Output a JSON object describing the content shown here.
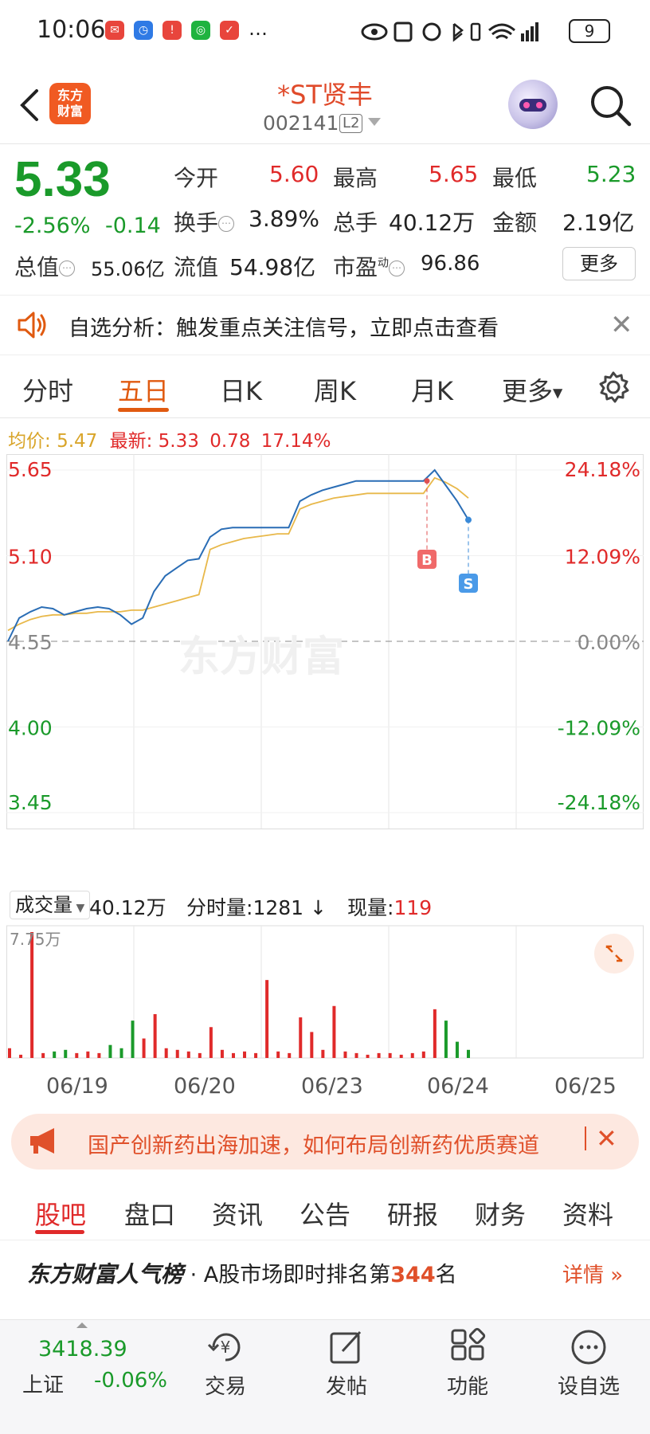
{
  "status_bar": {
    "time": "10:06",
    "battery": "9",
    "more": "…"
  },
  "header": {
    "title": "*ST贤丰",
    "code": "002141",
    "level": "L2",
    "logo_text": "东方财富"
  },
  "quote": {
    "price": "5.33",
    "change_pct": "-2.56%",
    "change_amt": "-0.14",
    "open_label": "今开",
    "open": "5.60",
    "high_label": "最高",
    "high": "5.65",
    "low_label": "最低",
    "low": "5.23",
    "turnover_label": "换手",
    "turnover": "3.89%",
    "volume_label": "总手",
    "volume": "40.12万",
    "amount_label": "金额",
    "amount": "2.19亿",
    "mcap_label": "总值",
    "mcap": "55.06亿",
    "float_label": "流值",
    "float": "54.98亿",
    "pe_label": "市盈",
    "pe_sup": "动",
    "pe": "96.86",
    "more_label": "更多"
  },
  "analysis_banner": {
    "text": "自选分析：触发重点关注信号，立即点击查看"
  },
  "tabs": [
    "分时",
    "五日",
    "日K",
    "周K",
    "月K",
    "更多"
  ],
  "legend": {
    "avg_label": "均价:",
    "avg": "5.47",
    "latest_label": "最新:",
    "latest": "5.33",
    "latest_chg": "0.78",
    "latest_pct": "17.14%"
  },
  "chart_data": {
    "type": "line",
    "y_left_ticks": [
      "5.65",
      "5.10",
      "4.55",
      "4.00",
      "3.45"
    ],
    "y_right_ticks": [
      "24.18%",
      "12.09%",
      "0.00%",
      "-12.09%",
      "-24.18%"
    ],
    "ylim": [
      3.45,
      5.65
    ],
    "prev_close": 4.55,
    "x_labels": [
      "06/19",
      "06/20",
      "06/23",
      "06/24",
      "06/25"
    ],
    "watermark": "东方财富",
    "series": [
      {
        "name": "price",
        "color": "#2a6db5",
        "values": [
          4.55,
          4.7,
          4.74,
          4.77,
          4.76,
          4.72,
          4.74,
          4.76,
          4.77,
          4.76,
          4.72,
          4.66,
          4.7,
          4.87,
          4.97,
          5.02,
          5.07,
          5.08,
          5.22,
          5.27,
          5.28,
          5.28,
          5.28,
          5.28,
          5.28,
          5.28,
          5.45,
          5.49,
          5.52,
          5.54,
          5.56,
          5.58,
          5.58,
          5.58,
          5.58,
          5.58,
          5.58,
          5.58,
          5.65,
          5.55,
          5.45,
          5.33
        ]
      },
      {
        "name": "avg",
        "color": "#e8b84a",
        "values": [
          4.62,
          4.66,
          4.69,
          4.71,
          4.72,
          4.72,
          4.73,
          4.73,
          4.74,
          4.74,
          4.74,
          4.75,
          4.75,
          4.77,
          4.79,
          4.81,
          4.83,
          4.85,
          5.14,
          5.17,
          5.19,
          5.21,
          5.22,
          5.23,
          5.24,
          5.24,
          5.4,
          5.43,
          5.45,
          5.47,
          5.48,
          5.49,
          5.5,
          5.5,
          5.5,
          5.5,
          5.5,
          5.5,
          5.6,
          5.57,
          5.53,
          5.47
        ]
      }
    ],
    "markers": [
      {
        "label": "B",
        "value": 5.58
      },
      {
        "label": "S",
        "value": 5.33
      }
    ],
    "volume": {
      "max_label": "7.75万",
      "values": [
        0.6,
        0.2,
        7.75,
        0.3,
        0.4,
        0.5,
        0.3,
        0.4,
        0.3,
        0.8,
        0.6,
        2.3,
        1.2,
        2.7,
        0.6,
        0.5,
        0.4,
        0.3,
        1.9,
        0.5,
        0.3,
        0.4,
        0.3,
        4.8,
        0.4,
        0.3,
        2.5,
        1.6,
        0.5,
        3.2,
        0.4,
        0.3,
        0.2,
        0.3,
        0.3,
        0.2,
        0.3,
        0.4,
        3.0,
        2.3,
        1.0,
        0.5
      ]
    }
  },
  "volume_header": {
    "select": "成交量",
    "total": "40.12万",
    "tick_label": "分时量:",
    "tick_value": "1281",
    "now_label": "现量:",
    "now_value": "119"
  },
  "news_banner": {
    "text": "国产创新药出海加速，如何布局创新药优质赛道"
  },
  "bottom_tabs": [
    "股吧",
    "盘口",
    "资讯",
    "公告",
    "研报",
    "财务",
    "资料"
  ],
  "rank": {
    "brand": "东方财富人气榜",
    "text": "· A股市场即时排名第",
    "num": "344",
    "suffix": "名",
    "detail": "详情"
  },
  "bottom_nav": {
    "index_value": "3418.39",
    "index_name": "上证",
    "index_chg": "-0.06%",
    "items": [
      "交易",
      "发帖",
      "功能",
      "设自选"
    ]
  },
  "colors": {
    "up": "#e02a2a",
    "down": "#1a9a2a",
    "accent": "#e05a10",
    "price_line": "#2a6db5",
    "avg_line": "#e8b84a"
  }
}
